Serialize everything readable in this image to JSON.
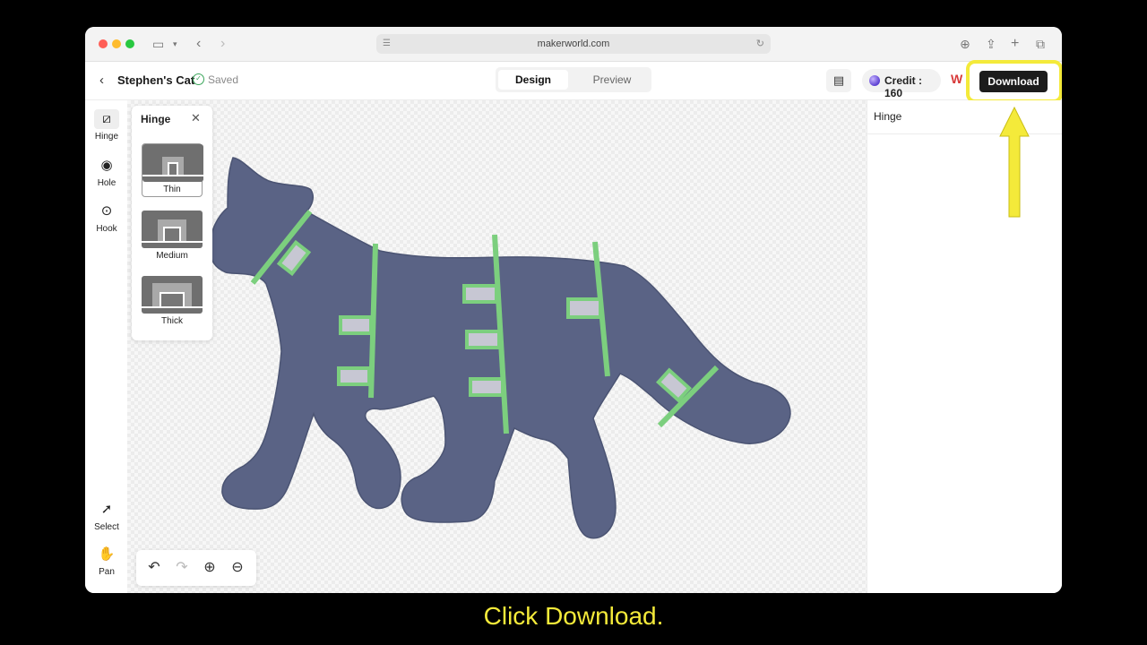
{
  "browser": {
    "url": "makerworld.com"
  },
  "header": {
    "back_icon": "chevron-left-icon",
    "title": "Stephen's Cat",
    "saved_label": "Saved",
    "tabs": [
      {
        "label": "Design",
        "active": true
      },
      {
        "label": "Preview",
        "active": false
      }
    ],
    "credit_label": "Credit : 160",
    "logo_text": "W",
    "download_label": "Download",
    "highlight_color": "#f4ea3a"
  },
  "tools": [
    {
      "label": "Hinge",
      "icon": "hinge-icon",
      "active": true
    },
    {
      "label": "Hole",
      "icon": "hole-icon",
      "active": false
    },
    {
      "label": "Hook",
      "icon": "hook-icon",
      "active": false
    },
    {
      "label": "Select",
      "icon": "cursor-icon",
      "active": false
    },
    {
      "label": "Pan",
      "icon": "hand-icon",
      "active": false
    }
  ],
  "hinge_panel": {
    "title": "Hinge",
    "options": [
      {
        "label": "Thin",
        "selected": true
      },
      {
        "label": "Medium",
        "selected": false
      },
      {
        "label": "Thick",
        "selected": false
      }
    ]
  },
  "canvas": {
    "shape_color": "#5a6385",
    "hinge_color": "#7ccf7e"
  },
  "right_panel": {
    "title": "Hinge"
  },
  "caption": "Click Download."
}
